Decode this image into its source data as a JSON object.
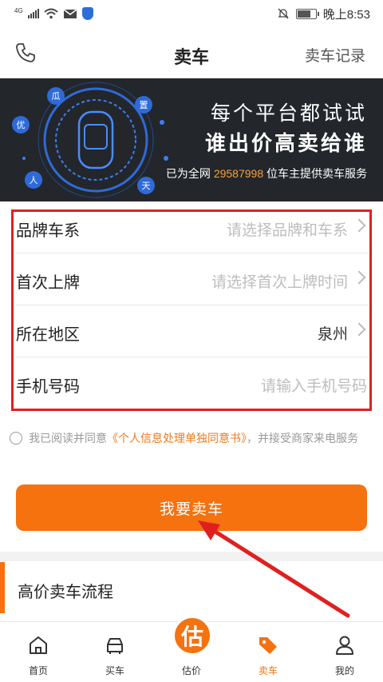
{
  "status_bar": {
    "network": "4G",
    "time": "晚上8:53",
    "battery_level": 0.75
  },
  "navbar": {
    "title": "卖车",
    "records_link": "卖车记录"
  },
  "banner": {
    "line1": "每个平台都试试",
    "line2": "谁出价高卖给谁",
    "line3_prefix": "已为全网",
    "count": "29587998",
    "line3_suffix": "位车主提供卖车服务",
    "ring_chars": [
      "优",
      "瓜",
      "置",
      "人",
      "天"
    ]
  },
  "form": {
    "rows": [
      {
        "label": "品牌车系",
        "value": "请选择品牌和车系"
      },
      {
        "label": "首次上牌",
        "value": "请选择首次上牌时间"
      },
      {
        "label": "所在地区",
        "value": "泉州"
      },
      {
        "label": "手机号码",
        "value": "请输入手机号码"
      }
    ]
  },
  "agreement": {
    "prefix": "我已阅读并同意",
    "link": "《个人信息处理单独同意书》",
    "suffix": "，并接受商家来电服务"
  },
  "submit_label": "我要卖车",
  "section": {
    "title": "高价卖车流程"
  },
  "tabbar": {
    "center_badge": "估",
    "tabs": [
      {
        "label": "首页",
        "icon": "home-icon"
      },
      {
        "label": "买车",
        "icon": "car-icon"
      },
      {
        "label": "估价",
        "icon": "valuation-icon"
      },
      {
        "label": "卖车",
        "icon": "tag-icon"
      },
      {
        "label": "我的",
        "icon": "user-icon"
      }
    ]
  },
  "colors": {
    "accent": "#f5720f",
    "banner_bg": "#23262b",
    "highlight": "#e02020"
  }
}
